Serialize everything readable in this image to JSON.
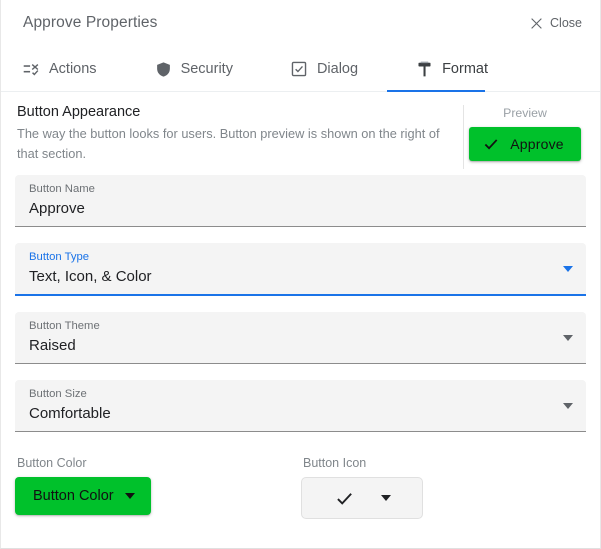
{
  "window": {
    "title": "Approve Properties",
    "close_label": "Close",
    "close_icon": "close-x-icon"
  },
  "tabs": {
    "items": [
      {
        "label": "Actions",
        "icon": "rule-lines-check-icon",
        "active": false
      },
      {
        "label": "Security",
        "icon": "shield-icon",
        "active": false
      },
      {
        "label": "Dialog",
        "icon": "check-box-icon",
        "active": false
      },
      {
        "label": "Format",
        "icon": "format-paint-icon",
        "active": true
      }
    ],
    "active_index": 3,
    "active_accent": "#1a73e8"
  },
  "section": {
    "title": "Button Appearance",
    "description": "The way the button looks for users. Button preview is shown on the right of that section."
  },
  "preview": {
    "label": "Preview",
    "button_label": "Approve",
    "button_icon": "check-icon",
    "button_color": "#00c12b",
    "button_text_color": "#111111"
  },
  "fields": [
    {
      "label": "Button Name",
      "value": "Approve",
      "type": "text",
      "focused": false,
      "has_caret": false,
      "name": "button-name-field"
    },
    {
      "label": "Button Type",
      "value": "Text, Icon, & Color",
      "type": "select",
      "focused": true,
      "has_caret": true,
      "name": "button-type-select"
    },
    {
      "label": "Button Theme",
      "value": "Raised",
      "type": "select",
      "focused": false,
      "has_caret": true,
      "name": "button-theme-select"
    },
    {
      "label": "Button Size",
      "value": "Comfortable",
      "type": "select",
      "focused": false,
      "has_caret": true,
      "name": "button-size-select"
    }
  ],
  "button_color_control": {
    "label": "Button Color",
    "button_label": "Button Color",
    "color": "#00c12b",
    "caret_icon": "chevron-down-icon"
  },
  "button_icon_control": {
    "label": "Button Icon",
    "selected_icon": "check-icon",
    "caret_icon": "chevron-down-icon"
  },
  "colors": {
    "accent_blue": "#1a73e8",
    "brand_green": "#00c12b",
    "field_bg": "#f4f4f4",
    "text_primary": "#202124",
    "text_secondary": "#5f6368",
    "text_muted": "#80868b"
  }
}
